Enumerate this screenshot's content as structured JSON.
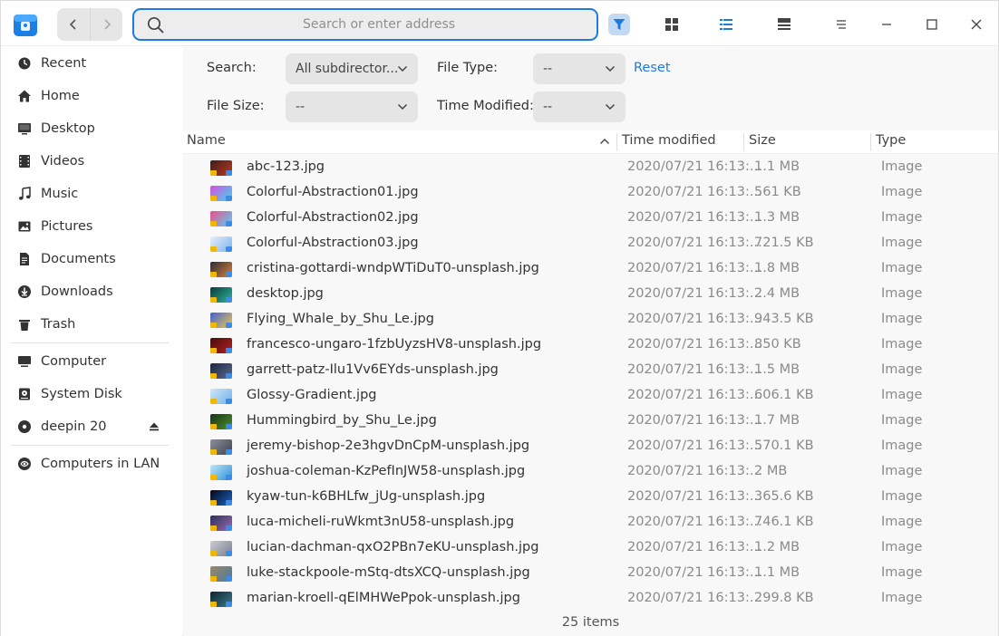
{
  "address": {
    "placeholder": "Search or enter address"
  },
  "sidebar": {
    "items": [
      {
        "label": "Recent",
        "icon": "clock-icon"
      },
      {
        "label": "Home",
        "icon": "home-icon"
      },
      {
        "label": "Desktop",
        "icon": "desktop-icon"
      },
      {
        "label": "Videos",
        "icon": "film-icon"
      },
      {
        "label": "Music",
        "icon": "music-note-icon"
      },
      {
        "label": "Pictures",
        "icon": "picture-icon"
      },
      {
        "label": "Documents",
        "icon": "document-icon"
      },
      {
        "label": "Downloads",
        "icon": "download-icon"
      },
      {
        "label": "Trash",
        "icon": "trash-icon"
      }
    ],
    "devices": [
      {
        "label": "Computer",
        "icon": "computer-icon"
      },
      {
        "label": "System Disk",
        "icon": "disk-icon"
      },
      {
        "label": "deepin 20",
        "icon": "drive-icon"
      }
    ],
    "network": [
      {
        "label": "Computers in LAN",
        "icon": "network-icon"
      }
    ]
  },
  "filter": {
    "search_label": "Search:",
    "search_value": "All subdirector...",
    "file_type_label": "File Type:",
    "file_type_value": "--",
    "reset_label": "Reset",
    "file_size_label": "File Size:",
    "file_size_value": "--",
    "time_modified_label": "Time Modified:",
    "time_modified_value": "--"
  },
  "columns": {
    "name": "Name",
    "time": "Time modified",
    "size": "Size",
    "type": "Type"
  },
  "files": [
    {
      "name": "abc-123.jpg",
      "time": "2020/07/21 16:13:...",
      "size": "1.1 MB",
      "type": "Image",
      "thumb": [
        "#3a1d1d",
        "#c0391e"
      ]
    },
    {
      "name": "Colorful-Abstraction01.jpg",
      "time": "2020/07/21 16:13:...",
      "size": "561 KB",
      "type": "Image",
      "thumb": [
        "#d94fe0",
        "#3dd7f0"
      ]
    },
    {
      "name": "Colorful-Abstraction02.jpg",
      "time": "2020/07/21 16:13:...",
      "size": "1.3 MB",
      "type": "Image",
      "thumb": [
        "#f04d8c",
        "#55d2f5"
      ]
    },
    {
      "name": "Colorful-Abstraction03.jpg",
      "time": "2020/07/21 16:13:...",
      "size": "721.5 KB",
      "type": "Image",
      "thumb": [
        "#e9eef8",
        "#7cb4f0"
      ]
    },
    {
      "name": "cristina-gottardi-wndpWTiDuT0-unsplash.jpg",
      "time": "2020/07/21 16:13:...",
      "size": "1.8 MB",
      "type": "Image",
      "thumb": [
        "#2b2b3a",
        "#d9823a"
      ]
    },
    {
      "name": "desktop.jpg",
      "time": "2020/07/21 16:13:...",
      "size": "2.4 MB",
      "type": "Image",
      "thumb": [
        "#0b3c3c",
        "#2fb49a"
      ]
    },
    {
      "name": "Flying_Whale_by_Shu_Le.jpg",
      "time": "2020/07/21 16:13:...",
      "size": "943.5 KB",
      "type": "Image",
      "thumb": [
        "#3e5fd8",
        "#f0c84a"
      ]
    },
    {
      "name": "francesco-ungaro-1fzbUyzsHV8-unsplash.jpg",
      "time": "2020/07/21 16:13:...",
      "size": "850 KB",
      "type": "Image",
      "thumb": [
        "#4a0d0d",
        "#b02020"
      ]
    },
    {
      "name": "garrett-patz-Ilu1Vv6EYds-unsplash.jpg",
      "time": "2020/07/21 16:13:...",
      "size": "1.5 MB",
      "type": "Image",
      "thumb": [
        "#1c2540",
        "#5a6a90"
      ]
    },
    {
      "name": "Glossy-Gradient.jpg",
      "time": "2020/07/21 16:13:...",
      "size": "606.1 KB",
      "type": "Image",
      "thumb": [
        "#cfe6f7",
        "#6fb3ea"
      ]
    },
    {
      "name": "Hummingbird_by_Shu_Le.jpg",
      "time": "2020/07/21 16:13:...",
      "size": "1.7 MB",
      "type": "Image",
      "thumb": [
        "#16331a",
        "#4f8f2a"
      ]
    },
    {
      "name": "jeremy-bishop-2e3hgvDnCpM-unsplash.jpg",
      "time": "2020/07/21 16:13:...",
      "size": "570.1 KB",
      "type": "Image",
      "thumb": [
        "#8a8f9a",
        "#3f4550"
      ]
    },
    {
      "name": "joshua-coleman-KzPefInJW58-unsplash.jpg",
      "time": "2020/07/21 16:13:...",
      "size": "2 MB",
      "type": "Image",
      "thumb": [
        "#bfe8f7",
        "#2a8fd8"
      ]
    },
    {
      "name": "kyaw-tun-k6BHLfw_jUg-unsplash.jpg",
      "time": "2020/07/21 16:13:...",
      "size": "365.6 KB",
      "type": "Image",
      "thumb": [
        "#050510",
        "#1a66cc"
      ]
    },
    {
      "name": "luca-micheli-ruWkmt3nU58-unsplash.jpg",
      "time": "2020/07/21 16:13:...",
      "size": "746.1 KB",
      "type": "Image",
      "thumb": [
        "#2a2f5a",
        "#9a6ab0"
      ]
    },
    {
      "name": "lucian-dachman-qxO2PBn7eKU-unsplash.jpg",
      "time": "2020/07/21 16:13:...",
      "size": "1.2 MB",
      "type": "Image",
      "thumb": [
        "#c9cbd0",
        "#7b8090"
      ]
    },
    {
      "name": "luke-stackpoole-mStq-dtsXCQ-unsplash.jpg",
      "time": "2020/07/21 16:13:...",
      "size": "1.1 MB",
      "type": "Image",
      "thumb": [
        "#9a8a6a",
        "#4a7a9a"
      ]
    },
    {
      "name": "marian-kroell-qElMHWePpok-unsplash.jpg",
      "time": "2020/07/21 16:13:...",
      "size": "299.8 KB",
      "type": "Image",
      "thumb": [
        "#0f2430",
        "#3a7a8a"
      ]
    }
  ],
  "status": {
    "count": "25 items"
  },
  "colors": {
    "accent": "#1f7ae0",
    "sidebar_bg": "#ffffff",
    "main_bg": "#f8f8f8"
  }
}
